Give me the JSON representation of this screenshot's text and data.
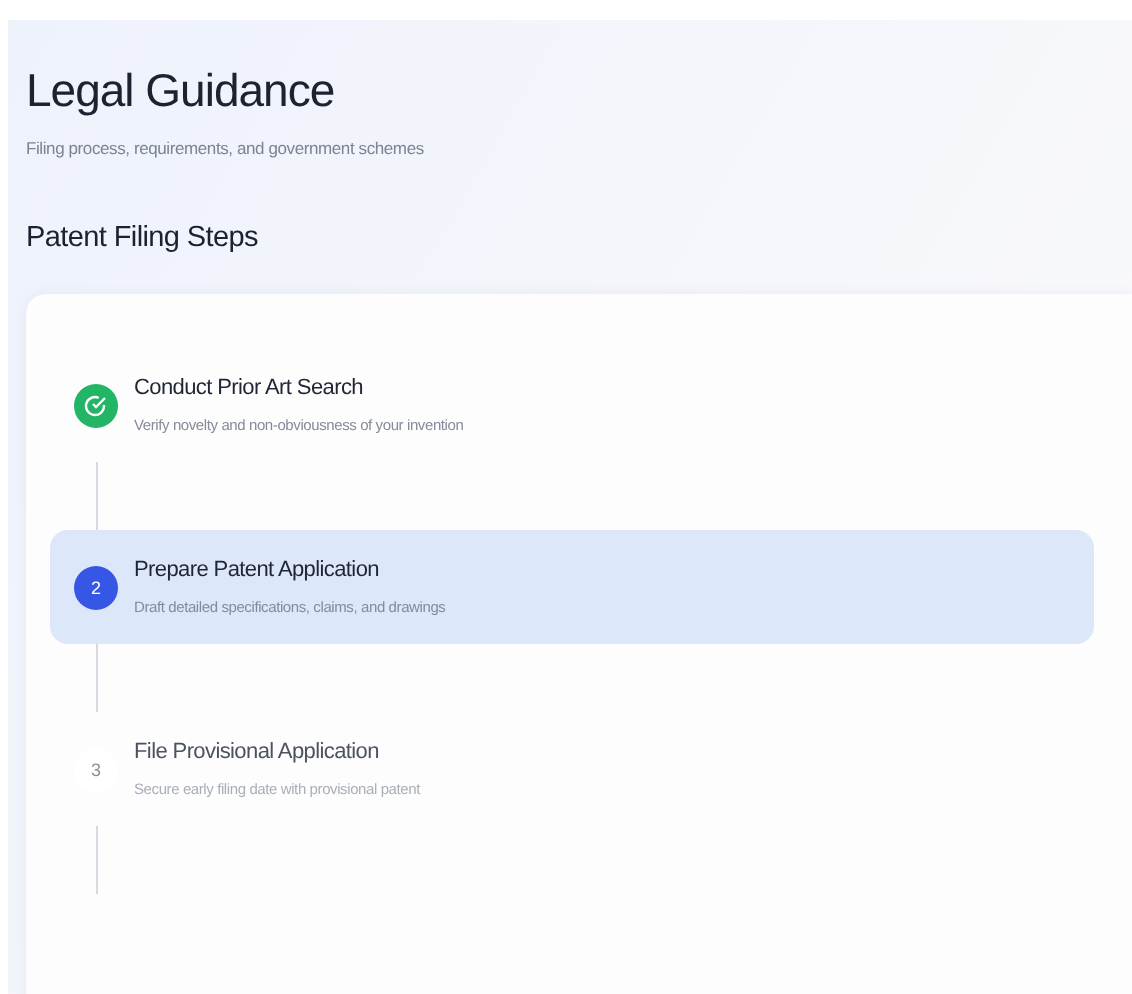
{
  "header": {
    "title": "Legal Guidance",
    "subtitle": "Filing process, requirements, and government schemes"
  },
  "section_title": "Patent Filing Steps",
  "steps": [
    {
      "completed": true,
      "title": "Conduct Prior Art Search",
      "description": "Verify novelty and non-obviousness of your invention",
      "selected": false
    },
    {
      "completed": false,
      "number": "2",
      "title": "Prepare Patent Application",
      "description": "Draft detailed specifications, claims, and drawings",
      "selected": true
    },
    {
      "completed": false,
      "number": "3",
      "title": "File Provisional Application",
      "description": "Secure early filing date with provisional patent",
      "selected": false
    }
  ]
}
